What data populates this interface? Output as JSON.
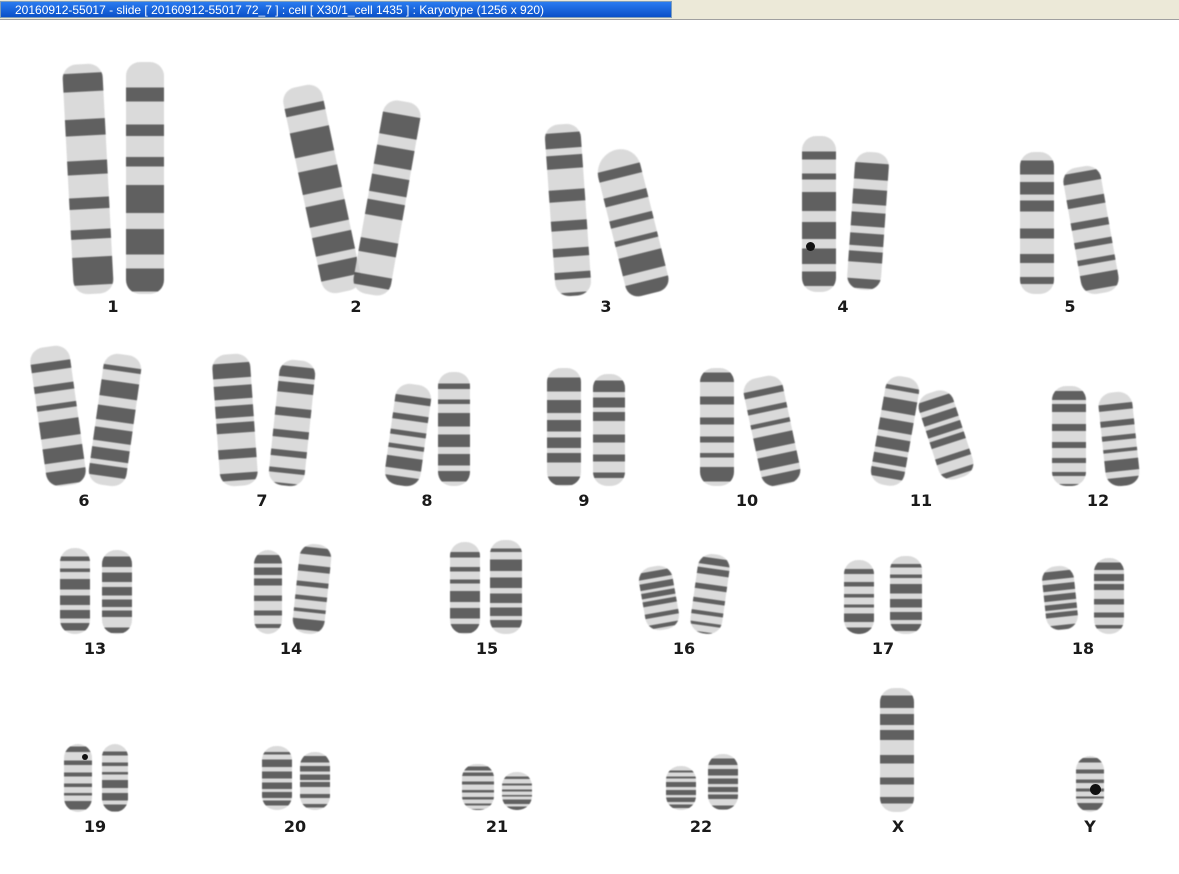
{
  "window": {
    "title": "20160912-55017 - slide [ 20160912-55017 72_7 ] : cell [ X30/1_cell 1435 ] : Karyotype  (1256 x 920)"
  },
  "karyotype": {
    "labels": [
      "1",
      "2",
      "3",
      "4",
      "5",
      "6",
      "7",
      "8",
      "9",
      "10",
      "11",
      "12",
      "13",
      "14",
      "15",
      "16",
      "17",
      "18",
      "19",
      "20",
      "21",
      "22",
      "X",
      "Y"
    ]
  },
  "colors": {
    "title_bar": "#0a50c8",
    "chromosome_band_dark": "#555555",
    "chromosome_band_light": "#d8d8d8"
  }
}
